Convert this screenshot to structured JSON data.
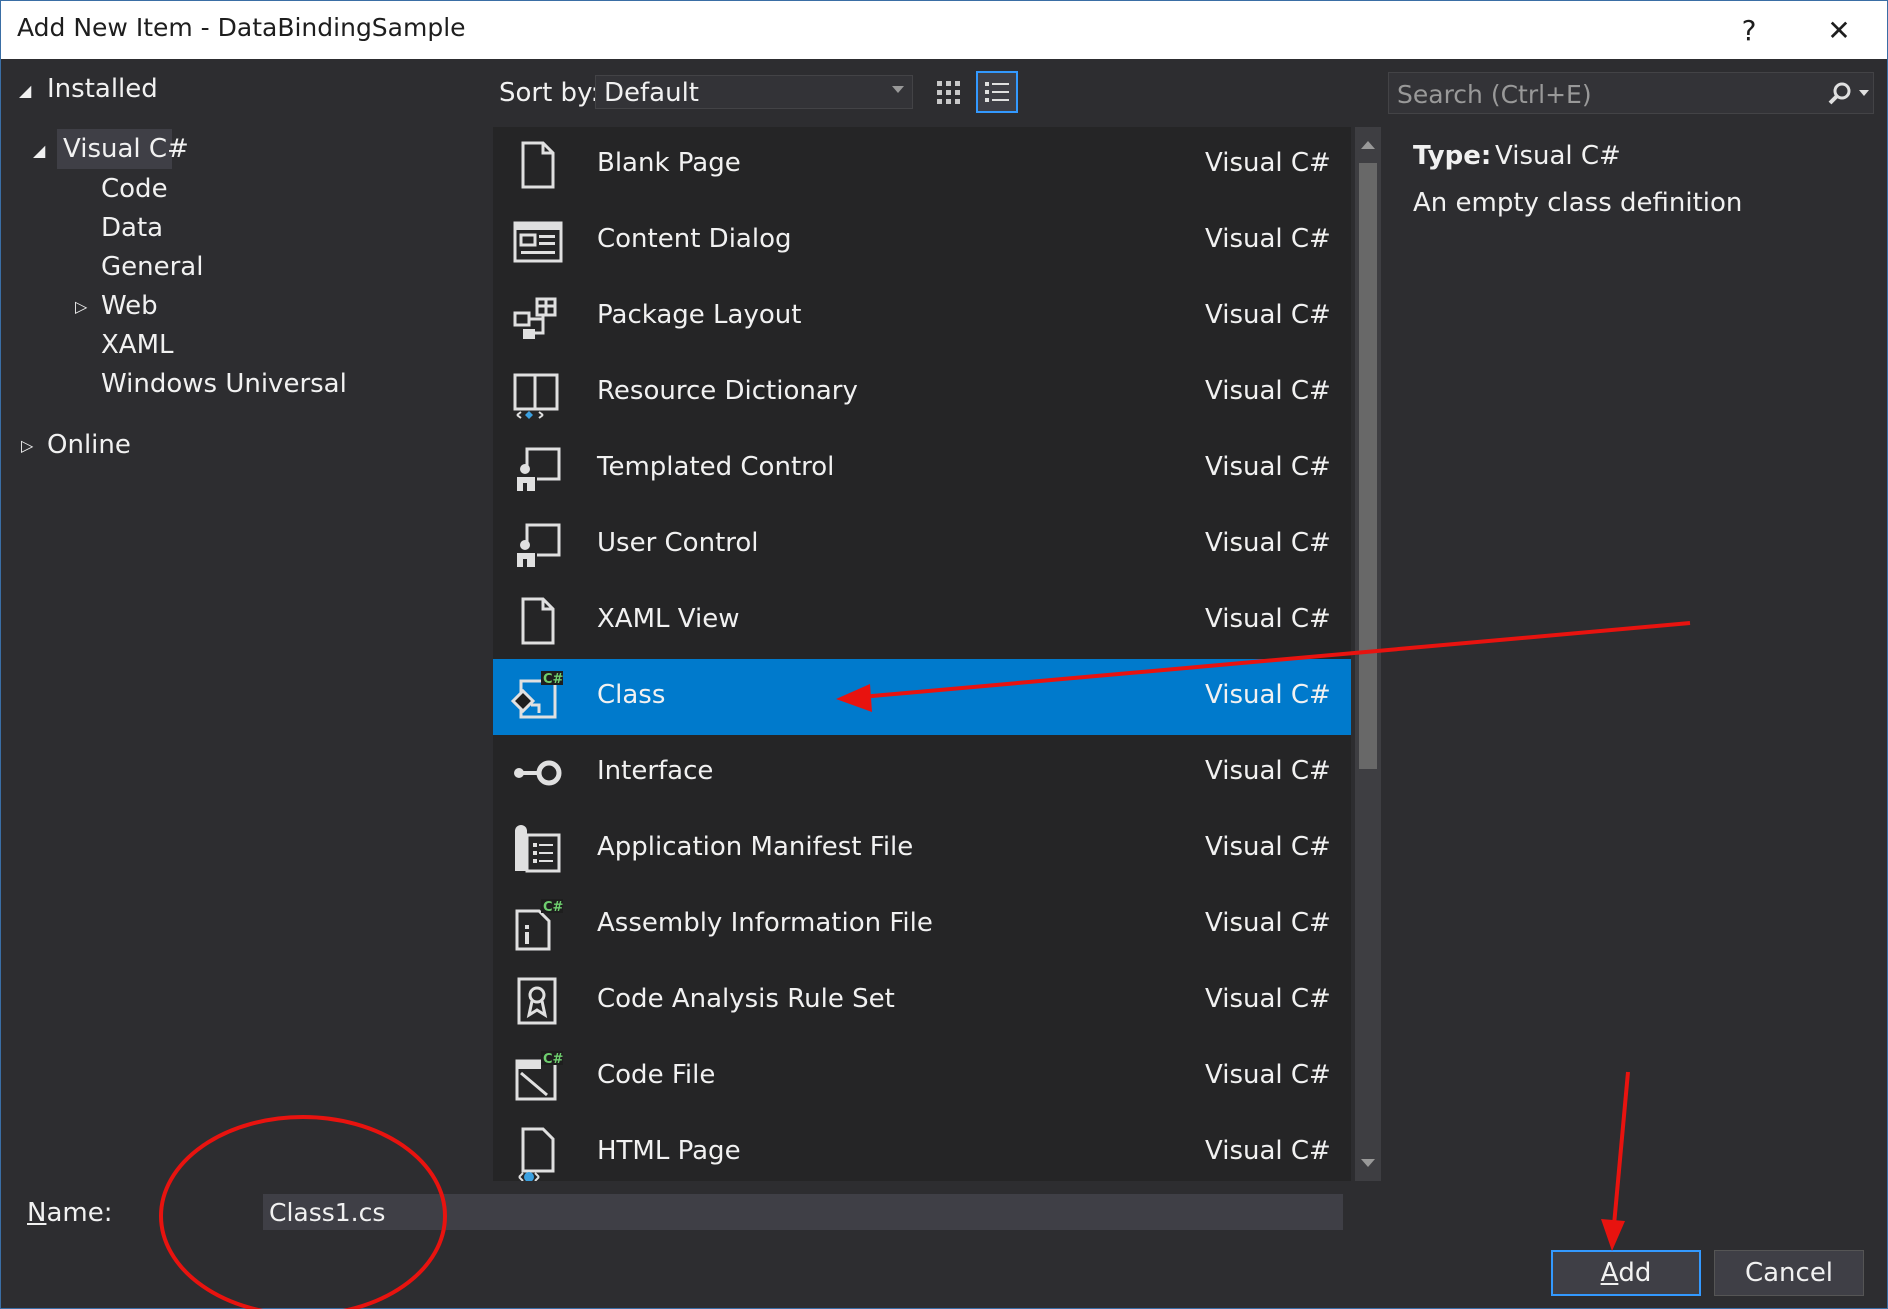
{
  "window": {
    "title": "Add New Item - DataBindingSample",
    "help_label": "?",
    "close_label": "✕"
  },
  "tree": {
    "installed": "Installed",
    "visual_csharp": "Visual C#",
    "children": [
      "Code",
      "Data",
      "General",
      "Web",
      "XAML",
      "Windows Universal"
    ],
    "online": "Online"
  },
  "toolbar": {
    "sort_label": "Sort by:",
    "sort_value": "Default"
  },
  "search": {
    "placeholder": "Search (Ctrl+E)"
  },
  "templates": [
    {
      "name": "Blank Page",
      "lang": "Visual C#",
      "icon": "page-icon"
    },
    {
      "name": "Content Dialog",
      "lang": "Visual C#",
      "icon": "dialog-icon"
    },
    {
      "name": "Package Layout",
      "lang": "Visual C#",
      "icon": "package-icon"
    },
    {
      "name": "Resource Dictionary",
      "lang": "Visual C#",
      "icon": "book-icon"
    },
    {
      "name": "Templated Control",
      "lang": "Visual C#",
      "icon": "control-icon"
    },
    {
      "name": "User Control",
      "lang": "Visual C#",
      "icon": "control-icon"
    },
    {
      "name": "XAML View",
      "lang": "Visual C#",
      "icon": "page-icon"
    },
    {
      "name": "Class",
      "lang": "Visual C#",
      "icon": "class-icon",
      "selected": true
    },
    {
      "name": "Interface",
      "lang": "Visual C#",
      "icon": "interface-icon"
    },
    {
      "name": "Application Manifest File",
      "lang": "Visual C#",
      "icon": "manifest-icon"
    },
    {
      "name": "Assembly Information File",
      "lang": "Visual C#",
      "icon": "info-file-icon"
    },
    {
      "name": "Code Analysis Rule Set",
      "lang": "Visual C#",
      "icon": "ruleset-icon"
    },
    {
      "name": "Code File",
      "lang": "Visual C#",
      "icon": "code-file-icon"
    },
    {
      "name": "HTML Page",
      "lang": "Visual C#",
      "icon": "html-page-icon"
    }
  ],
  "details": {
    "type_label": "Type:",
    "type_value": "Visual C#",
    "description": "An empty class definition"
  },
  "footer": {
    "name_label_mnemonic": "N",
    "name_label_rest": "ame:",
    "name_value": "Class1.cs",
    "add_mnemonic": "A",
    "add_rest": "dd",
    "cancel_label": "Cancel"
  },
  "colors": {
    "background": "#2d2d30",
    "list_background": "#252526",
    "selection": "#007acc",
    "accent_border": "#3399ff",
    "annotation": "#e8130f"
  }
}
